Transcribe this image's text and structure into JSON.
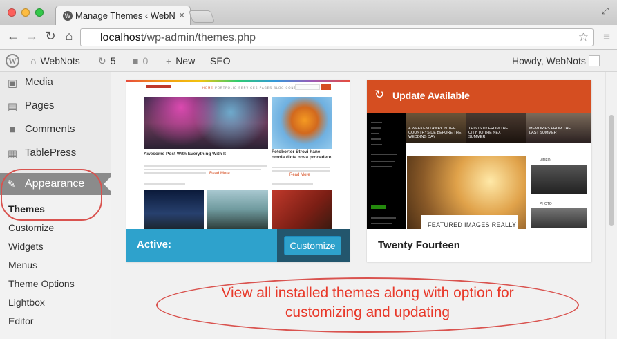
{
  "browser": {
    "tab_title": "Manage Themes ‹ WebNots",
    "tab_close": "×",
    "url_host": "localhost",
    "url_path": "/wp-admin/themes.php"
  },
  "admin_bar": {
    "site_name": "WebNots",
    "updates_count": "5",
    "comments_count": "0",
    "new_label": "New",
    "seo_label": "SEO",
    "howdy": "Howdy, WebNots"
  },
  "sidebar": {
    "items": [
      {
        "label": "Media",
        "icon": "media-icon"
      },
      {
        "label": "Pages",
        "icon": "pages-icon"
      },
      {
        "label": "Comments",
        "icon": "comments-icon"
      },
      {
        "label": "TablePress",
        "icon": "table-icon"
      }
    ],
    "appearance": "Appearance",
    "submenu": [
      "Themes",
      "Customize",
      "Widgets",
      "Menus",
      "Theme Options",
      "Lightbox",
      "Editor"
    ]
  },
  "themes": {
    "active": {
      "status_label": "Active:",
      "customize_label": "Customize",
      "preview": {
        "nav": [
          "HOME",
          "PORTFOLIO",
          "SERVICES",
          "PAGES",
          "BLOG",
          "CONTACT"
        ],
        "post1_title": "Awesome Post With Everything With It",
        "post2_title": "Fotobortor Strovi hane omnia dicta nova procedere",
        "read_more": "Read More"
      }
    },
    "second": {
      "update_label": "Update Available",
      "name": "Twenty Fourteen",
      "preview": {
        "cap1": "A WEEKEND AWAY IN THE",
        "cap1b": "COUNTRYSIDE BEFORE THE",
        "cap1c": "WEDDING DAY",
        "cap2": "THIS IS IT! FROM THE",
        "cap2b": "CITY TO THE NEXT",
        "cap2c": "SUMMER!",
        "cap3": "MEMORIES FROM THE",
        "cap3b": "LAST SUMMER",
        "featured": "FEATURED IMAGES REALLY",
        "video_label": "VIDEO",
        "photo_label": "PHOTO"
      }
    }
  },
  "annotation": {
    "line1": "View all installed themes along with option for",
    "line2": "customizing and updating"
  }
}
